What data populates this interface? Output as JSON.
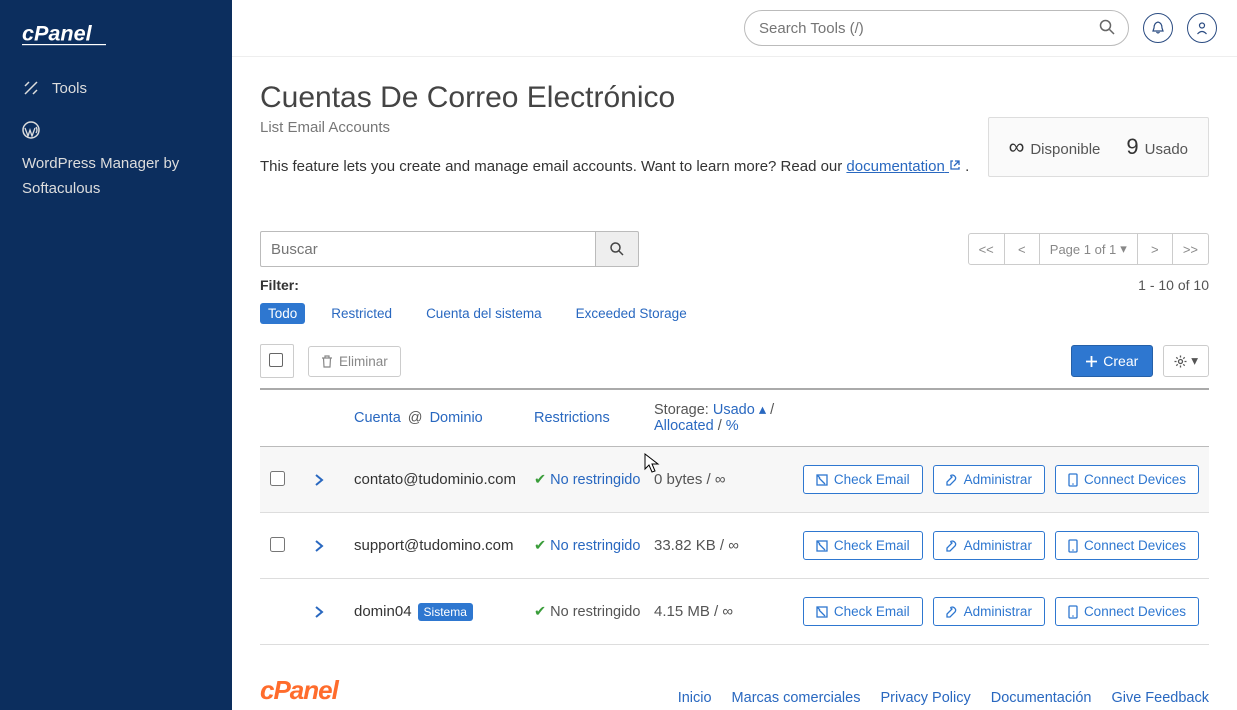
{
  "header": {
    "search_placeholder": "Search Tools (/)"
  },
  "sidebar": {
    "tools_label": "Tools",
    "wp_label": "WordPress Manager by Softaculous"
  },
  "page": {
    "title": "Cuentas De Correo Electrónico",
    "subtitle": "List Email Accounts",
    "desc_pre": "This feature lets you create and manage email accounts. Want to learn more? Read our ",
    "desc_link": "documentation",
    "desc_post": " ."
  },
  "stats": {
    "available_sym": "∞",
    "available_label": "Disponible",
    "used_count": "9",
    "used_label": "Usado"
  },
  "search": {
    "placeholder": "Buscar"
  },
  "pagination": {
    "first": "<<",
    "prev": "<",
    "label": "Page 1 of 1",
    "next": ">",
    "last": ">>",
    "range": "1 - 10 of 10"
  },
  "filter": {
    "label": "Filter:",
    "all": "Todo",
    "restricted": "Restricted",
    "system": "Cuenta del sistema",
    "exceeded": "Exceeded Storage"
  },
  "bulk": {
    "delete": "Eliminar",
    "create": "Crear"
  },
  "thead": {
    "account": "Cuenta",
    "at": "@",
    "domain": "Dominio",
    "restrictions": "Restrictions",
    "storage_pre": "Storage:",
    "storage_used": "Usado",
    "storage_slash": "/",
    "storage_alloc": "Allocated",
    "storage_pct": "%"
  },
  "actions": {
    "check": "Check Email",
    "manage": "Administrar",
    "connect": "Connect Devices"
  },
  "rows": [
    {
      "email": "contato@tudominio.com",
      "restriction": "No restringido",
      "restriction_link": true,
      "storage": "0 bytes / ∞",
      "checkbox": true,
      "system": false
    },
    {
      "email": "support@tudomino.com",
      "restriction": "No restringido",
      "restriction_link": true,
      "storage": "33.82 KB / ∞",
      "checkbox": true,
      "system": false
    },
    {
      "email": "domin04",
      "restriction": "No restringido",
      "restriction_link": false,
      "storage": "4.15 MB / ∞",
      "checkbox": false,
      "system": true,
      "system_label": "Sistema"
    }
  ],
  "footer": {
    "links": [
      "Inicio",
      "Marcas comerciales",
      "Privacy Policy",
      "Documentación",
      "Give Feedback"
    ]
  }
}
